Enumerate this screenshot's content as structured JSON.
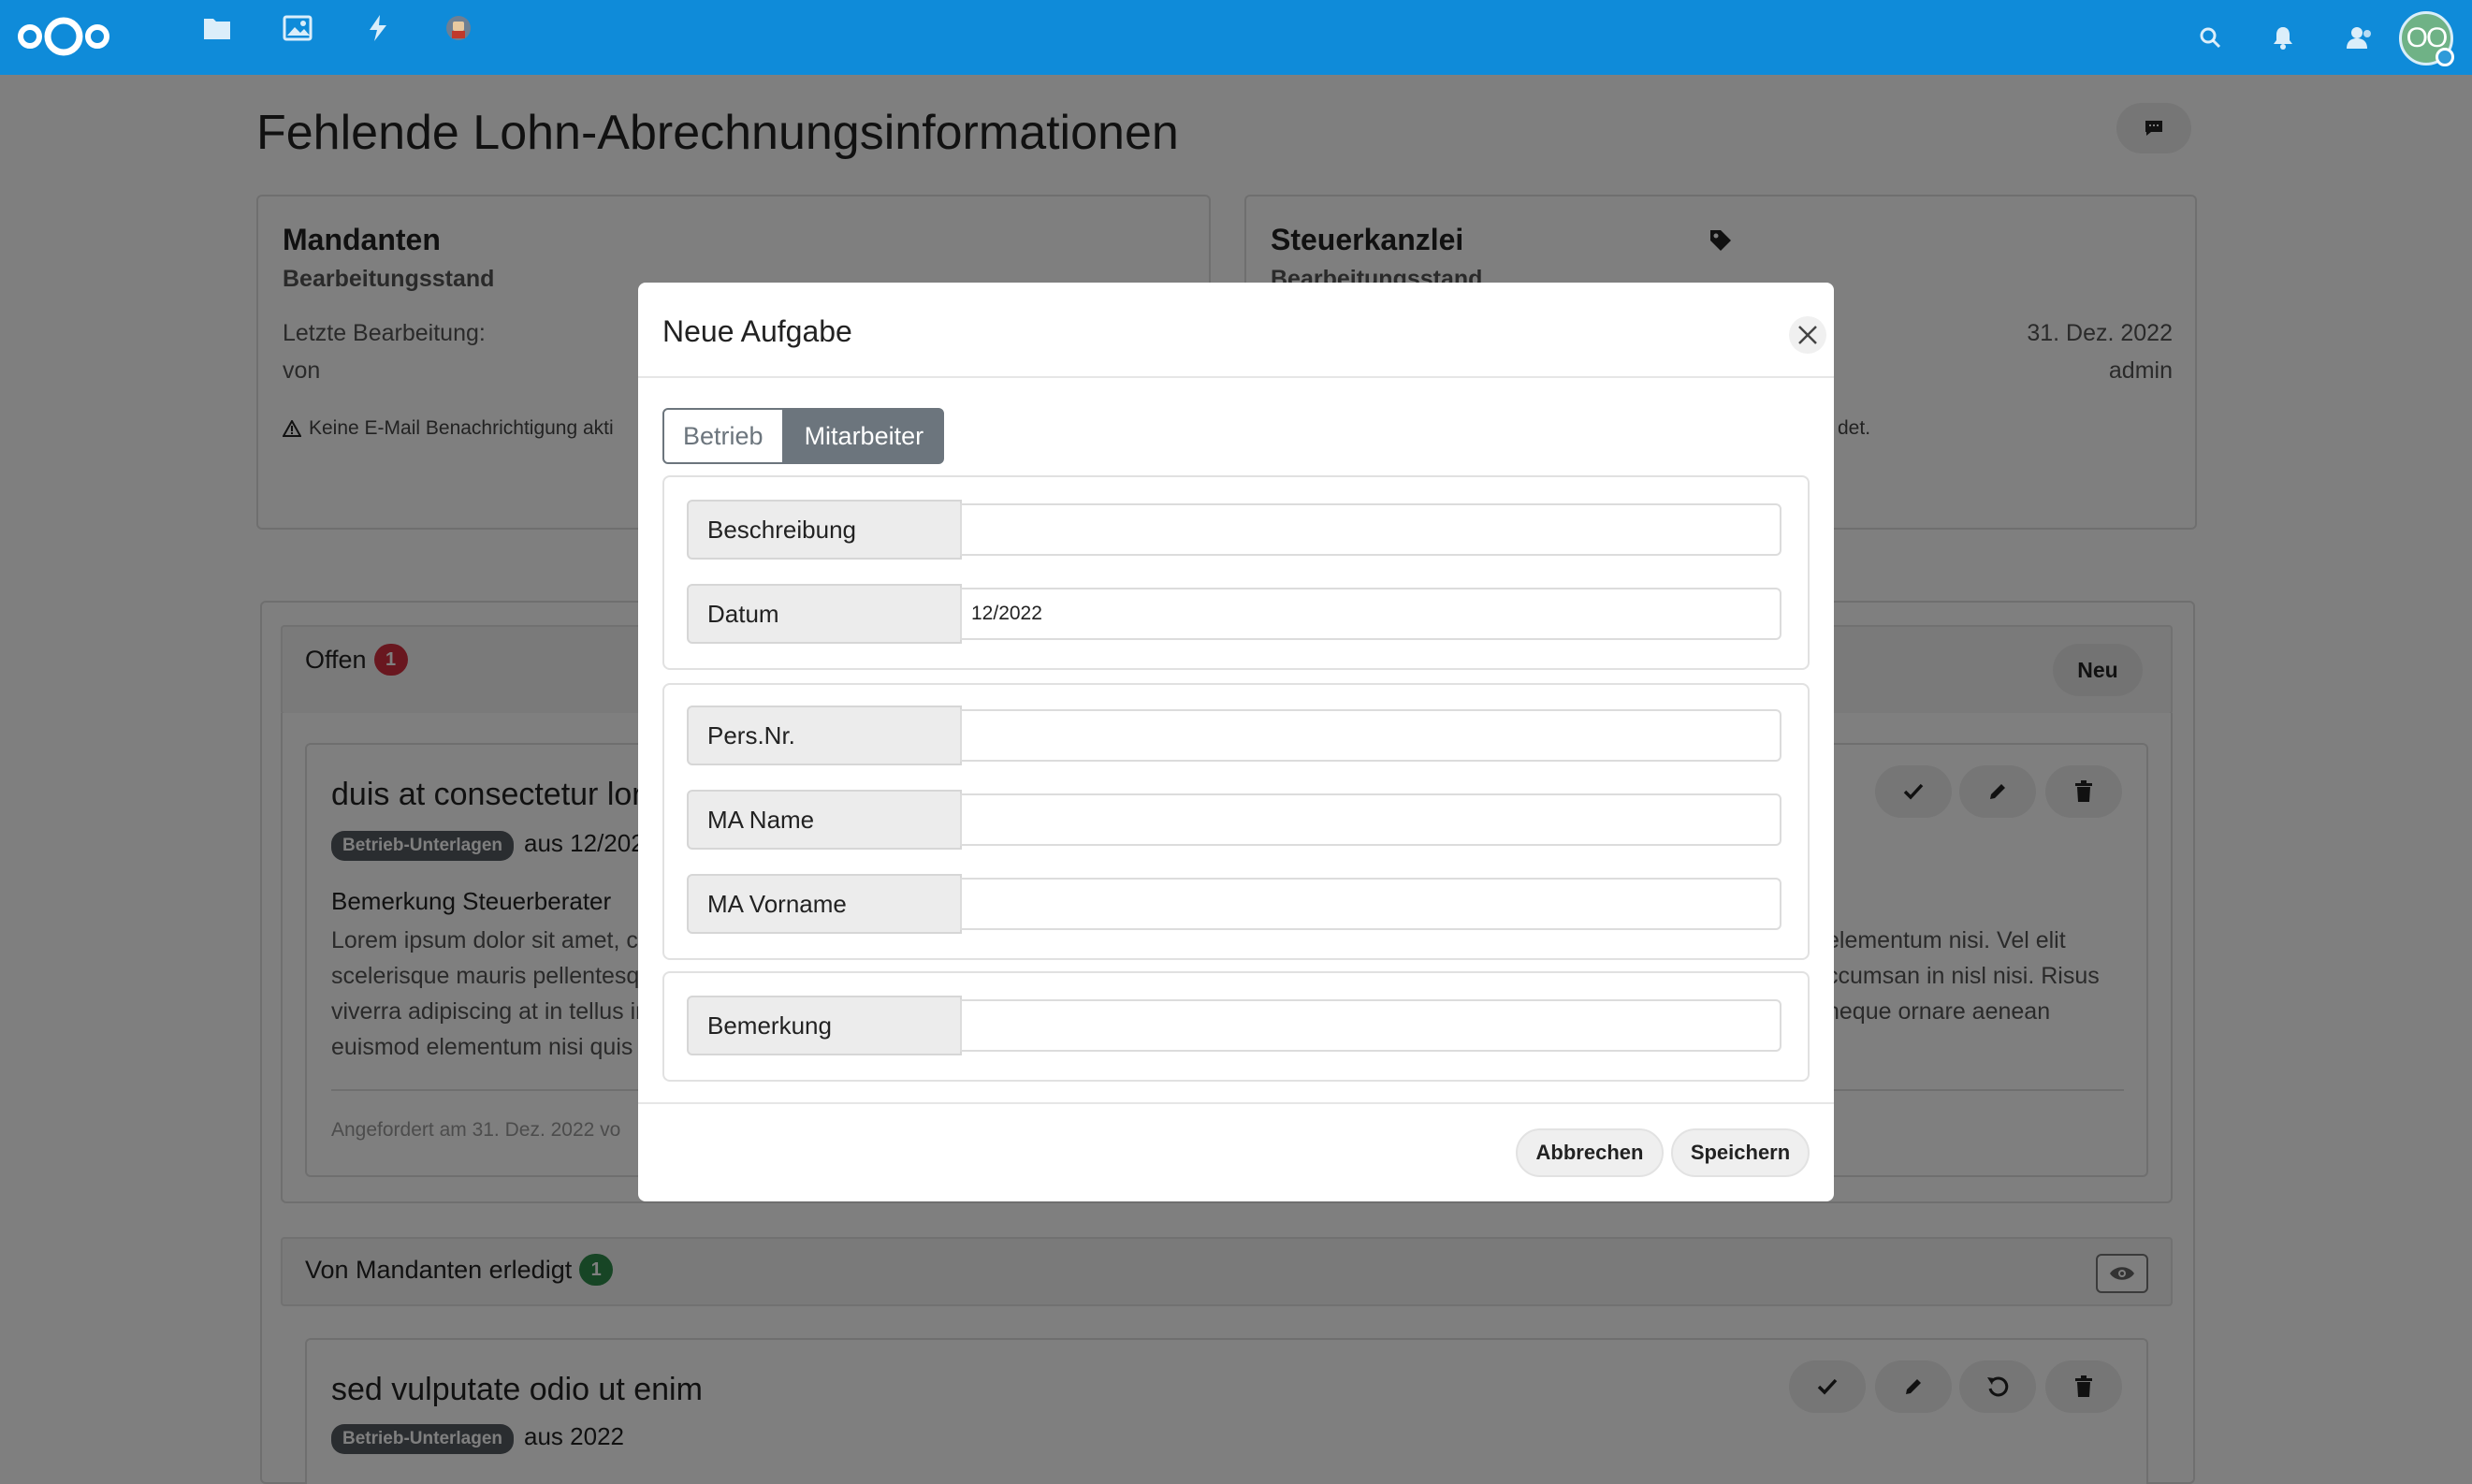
{
  "topbar": {
    "bg_color": "#0f8bd9",
    "logo": "nextcloud-logo",
    "apps": [
      "files-icon",
      "photos-icon",
      "activity-icon",
      "custom-app-icon"
    ],
    "right_icons": [
      "search-icon",
      "bell-icon",
      "contacts-icon"
    ],
    "avatar_initials": "OO"
  },
  "page": {
    "title": "Fehlende Lohn-Abrechnungsinformationen",
    "mandanten_card": {
      "heading": "Mandanten",
      "subheading": "Bearbeitungsstand",
      "last_edit_label": "Letzte Bearbeitung:",
      "by_label": "von",
      "warning": "Keine E-Mail Benachrichtigung akti"
    },
    "kanzlei_card": {
      "heading": "Steuerkanzlei",
      "subheading": "Bearbeitungsstand",
      "date": "31. Dez. 2022",
      "user": "admin",
      "tail_text": "det."
    },
    "offen": {
      "label": "Offen",
      "count": "1",
      "new_button": "Neu",
      "task": {
        "title": "duis at consectetur lore",
        "tag": "Betrieb-Unterlagen",
        "period": "aus 12/202",
        "remark_label": "Bemerkung Steuerberater",
        "lorem_left": [
          "Lorem ipsum dolor sit amet, co",
          "scelerisque mauris pellentesqu",
          "viverra adipiscing at in tellus int",
          "euismod elementum nisi quis e"
        ],
        "lorem_right": [
          "elementum nisi. Vel elit",
          "ccumsan in nisl nisi. Risus",
          "neque ornare aenean",
          ""
        ],
        "requested": "Angefordert am 31. Dez. 2022 vo"
      }
    },
    "erledigt": {
      "label": "Von Mandanten erledigt",
      "count": "1",
      "task": {
        "title": "sed vulputate odio ut enim",
        "tag": "Betrieb-Unterlagen",
        "period": "aus 2022"
      }
    }
  },
  "modal": {
    "title": "Neue Aufgabe",
    "tabs": [
      "Betrieb",
      "Mitarbeiter"
    ],
    "active_tab": "Mitarbeiter",
    "fields": {
      "beschreibung": {
        "label": "Beschreibung",
        "value": ""
      },
      "datum": {
        "label": "Datum",
        "value": "12/2022"
      },
      "persnr": {
        "label": "Pers.Nr.",
        "value": ""
      },
      "ma_name": {
        "label": "MA Name",
        "value": ""
      },
      "ma_vorname": {
        "label": "MA Vorname",
        "value": ""
      },
      "bemerkung": {
        "label": "Bemerkung",
        "value": ""
      }
    },
    "cancel_label": "Abbrechen",
    "save_label": "Speichern"
  }
}
